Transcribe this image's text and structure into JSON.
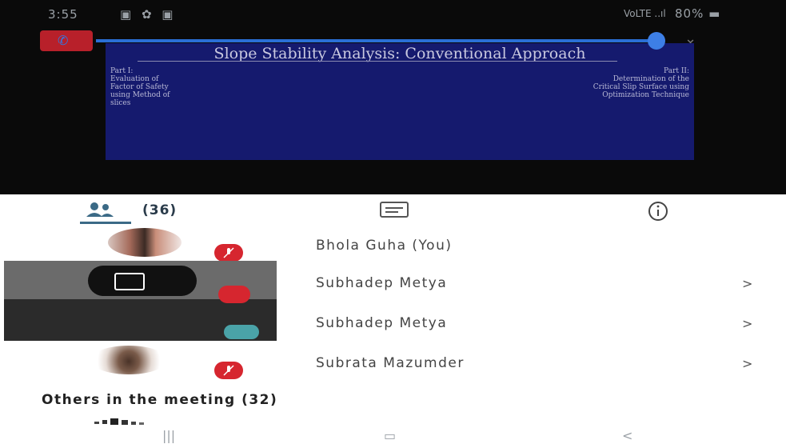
{
  "status_bar": {
    "time": "3:55",
    "icons": "▣ ✿ ▣",
    "signal": "VoLTE ..ıl",
    "battery": "80% ▬"
  },
  "slide": {
    "title": "Slope Stability Analysis: Conventional Approach",
    "part1": "Part I:\nEvaluation of\nFactor of Safety\nusing Method of\nslices",
    "part2": "Part II:\nDetermination of the\nCritical Slip Surface using\nOptimization Technique"
  },
  "tabs": {
    "people_count": "(36)",
    "people_icon": "people-icon",
    "chat_icon": "chat-icon",
    "info_icon": "info-icon"
  },
  "participants": [
    {
      "name": "Bhola Guha (You)",
      "muted": true,
      "has_chevron": false
    },
    {
      "name": "Subhadep Metya",
      "muted": true,
      "has_chevron": true
    },
    {
      "name": "Subhadep Metya",
      "muted": false,
      "has_chevron": true
    },
    {
      "name": "Subrata Mazumder",
      "muted": true,
      "has_chevron": true
    }
  ],
  "chevron": ">",
  "others_heading": "Others in the meeting (32)",
  "nav": {
    "recents": "|||",
    "home": "▭",
    "back": "<"
  },
  "colors": {
    "mute_red": "#d6262f",
    "tab_accent": "#3b6a86",
    "slide_bg": "#151a6e"
  }
}
